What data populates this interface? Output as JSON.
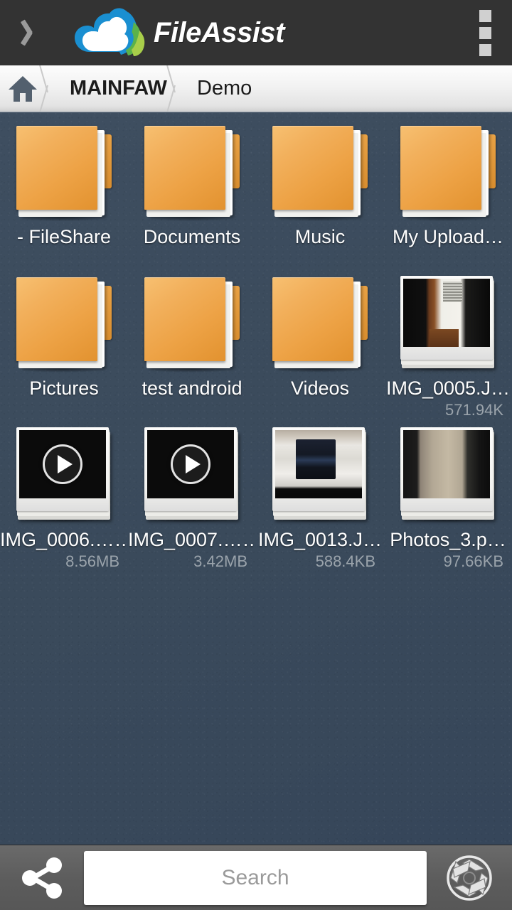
{
  "app": {
    "name": "FileAssist",
    "back_icon": "chevron-left-icon",
    "overflow_icon": "overflow-menu-icon",
    "logo_icon": "cloud-leaf-logo-icon"
  },
  "breadcrumb": {
    "home_icon": "home-icon",
    "items": [
      {
        "label": "MAINFAW",
        "bold": true
      },
      {
        "label": "Demo",
        "bold": false
      }
    ]
  },
  "files": [
    {
      "name": "- FileShare",
      "size": "",
      "type": "folder"
    },
    {
      "name": "Documents",
      "size": "",
      "type": "folder"
    },
    {
      "name": "Music",
      "size": "",
      "type": "folder"
    },
    {
      "name": "My Upload…",
      "size": "",
      "type": "folder"
    },
    {
      "name": "Pictures",
      "size": "",
      "type": "folder"
    },
    {
      "name": "test android",
      "size": "",
      "type": "folder"
    },
    {
      "name": "Videos",
      "size": "",
      "type": "folder"
    },
    {
      "name": "IMG_0005.J…",
      "size": "571.94K",
      "type": "photo",
      "scene": "hall"
    },
    {
      "name": "IMG_0006.……",
      "size": "8.56MB",
      "type": "video"
    },
    {
      "name": "IMG_0007.……",
      "size": "3.42MB",
      "type": "video"
    },
    {
      "name": "IMG_0013.J…",
      "size": "588.4KB",
      "type": "photo",
      "scene": "gear"
    },
    {
      "name": "Photos_3.p…",
      "size": "97.66KB",
      "type": "photo",
      "scene": "wall"
    }
  ],
  "bottom": {
    "share_icon": "share-icon",
    "camera_icon": "camera-aperture-icon",
    "search_placeholder": "Search",
    "search_value": ""
  },
  "colors": {
    "topbar": "#333333",
    "background": "#3b4b5d",
    "folder": "#eda245",
    "accent_blue": "#1a8fd1",
    "accent_green": "#8cc63f",
    "bottombar": "#5d5d5d"
  }
}
